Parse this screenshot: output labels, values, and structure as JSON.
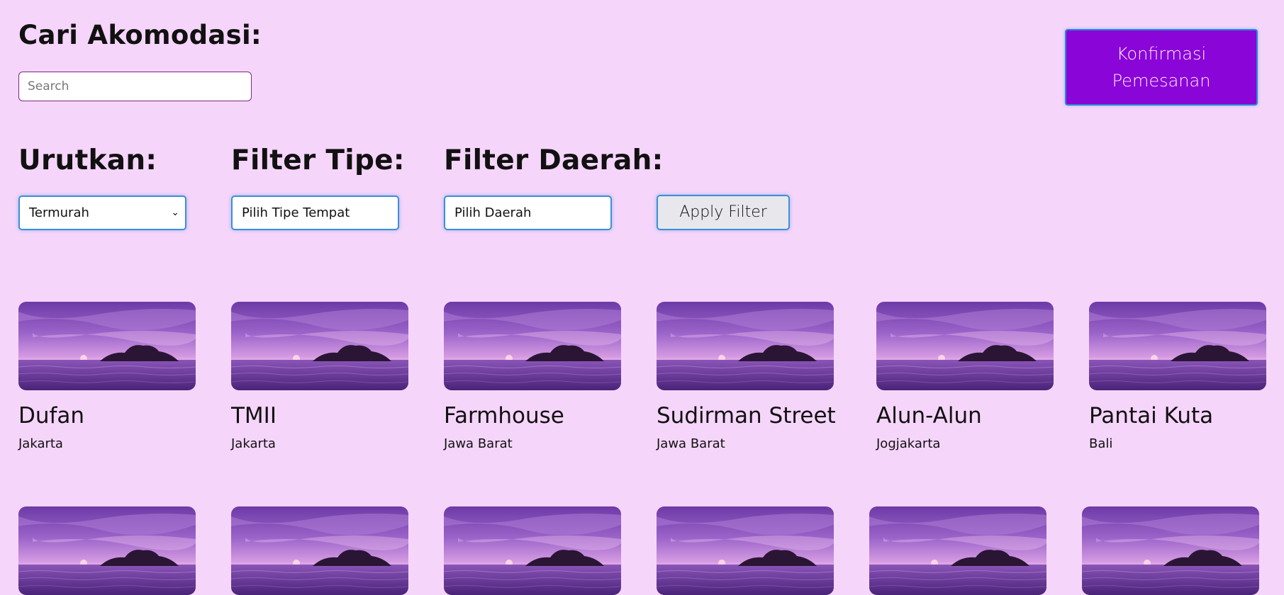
{
  "header": {
    "title": "Cari Akomodasi:",
    "search_placeholder": "Search"
  },
  "confirm_button": {
    "label": "Konfirmasi Pemesanan",
    "color": "#8a05d8"
  },
  "filters": {
    "sort_heading": "Urutkan:",
    "sort_value": "Termurah",
    "type_heading": "Filter Tipe:",
    "type_value": "Pilih Tipe Tempat",
    "region_heading": "Filter Daerah:",
    "region_value": "Pilih Daerah",
    "apply_label": "Apply Filter"
  },
  "theme": {
    "background": "#f6d5fb",
    "accent": "#8a05d8",
    "focus_border": "#3c8fd6"
  },
  "places": [
    {
      "name": "Dufan",
      "region": "Jakarta"
    },
    {
      "name": "TMII",
      "region": "Jakarta"
    },
    {
      "name": "Farmhouse",
      "region": "Jawa Barat"
    },
    {
      "name": "Sudirman Street",
      "region": "Jawa Barat"
    },
    {
      "name": "Alun-Alun",
      "region": "Jogjakarta"
    },
    {
      "name": "Pantai Kuta",
      "region": "Bali"
    }
  ]
}
